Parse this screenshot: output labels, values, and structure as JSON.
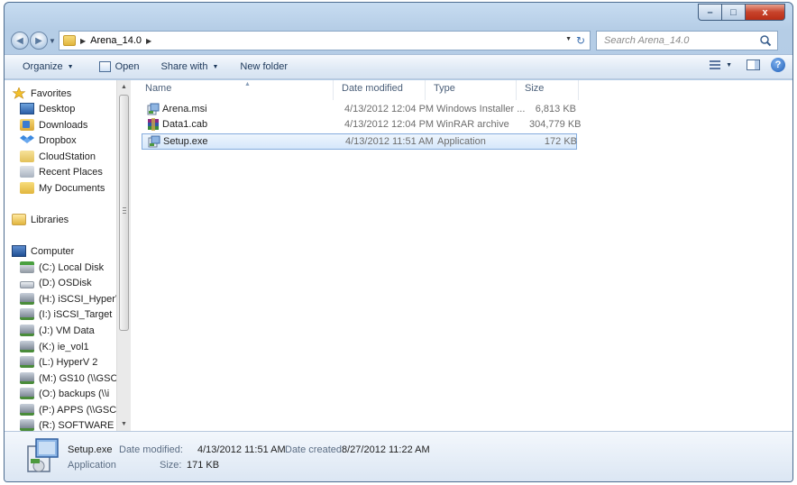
{
  "window": {
    "caption": "Arena_14.0",
    "controls": {
      "minimize": "–",
      "maximize": "□",
      "close": "x"
    }
  },
  "address_bar": {
    "breadcrumb": [
      "Arena_14.0"
    ],
    "search_placeholder": "Search Arena_14.0"
  },
  "toolbar": {
    "organize": "Organize",
    "open": "Open",
    "share_with": "Share with",
    "new_folder": "New folder"
  },
  "nav": {
    "favorites": {
      "label": "Favorites",
      "items": [
        "Desktop",
        "Downloads",
        "Dropbox",
        "CloudStation",
        "Recent Places",
        "My Documents"
      ]
    },
    "libraries": {
      "label": "Libraries"
    },
    "computer": {
      "label": "Computer",
      "drives": [
        "(C:) Local Disk",
        "(D:) OSDisk",
        "(H:) iSCSI_HyperV",
        "(I:) iSCSI_Target",
        "(J:) VM Data",
        "(K:) ie_vol1",
        "(L:) HyperV 2",
        "(M:) GS10 (\\\\GSC",
        "(O:) backups (\\\\i",
        "(P:) APPS (\\\\GSC",
        "(R:) SOFTWARE ("
      ]
    }
  },
  "columns": {
    "name": "Name",
    "date": "Date modified",
    "type": "Type",
    "size": "Size"
  },
  "files": [
    {
      "name": "Arena.msi",
      "date": "4/13/2012 12:04 PM",
      "type": "Windows Installer ...",
      "size": "6,813 KB",
      "icon": "installer-icon"
    },
    {
      "name": "Data1.cab",
      "date": "4/13/2012 12:04 PM",
      "type": "WinRAR archive",
      "size": "304,779 KB",
      "icon": "winrar-icon"
    },
    {
      "name": "Setup.exe",
      "date": "4/13/2012 11:51 AM",
      "type": "Application",
      "size": "172 KB",
      "icon": "setup-icon",
      "selected": true
    }
  ],
  "details": {
    "name": "Setup.exe",
    "type": "Application",
    "date_modified_label": "Date modified:",
    "date_modified": "4/13/2012 11:51 AM",
    "size_label": "Size:",
    "size": "171 KB",
    "date_created_label": "Date created:",
    "date_created": "8/27/2012 11:22 AM"
  },
  "colors": {
    "selection_fill": "#d5e7fb",
    "selection_border": "#84acdd",
    "window_frame": "#adc6e2",
    "close_button": "#c7432b"
  }
}
